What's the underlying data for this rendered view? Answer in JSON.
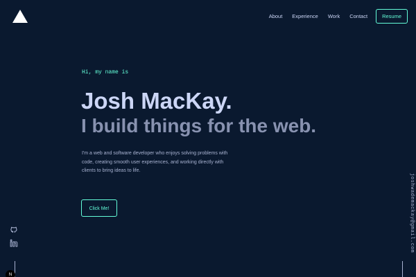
{
  "nav": {
    "links": [
      "About",
      "Experience",
      "Work",
      "Contact"
    ],
    "resume_label": "Resume"
  },
  "hero": {
    "greeting": "Hi, my name is",
    "name": "Josh MacKay.",
    "tagline": "I build things for the web.",
    "intro": "I'm a web and software developer who enjoys solving problems with code, creating smooth user experiences, and working directly with clients to bring ideas to life.",
    "cta_label": "Click Me!"
  },
  "social": {
    "icons": [
      "github-icon",
      "linkedin-icon"
    ]
  },
  "email": "joshwademackay@gmail.com",
  "badge": "N",
  "colors": {
    "background": "#0a192f",
    "accent": "#64ffda",
    "heading": "#ccd6f6",
    "muted": "#8892b0"
  }
}
